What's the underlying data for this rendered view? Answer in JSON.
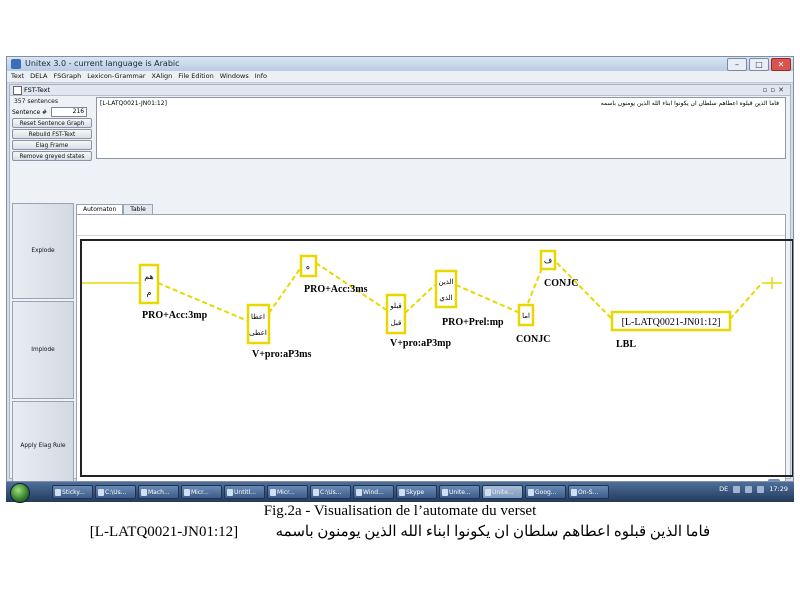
{
  "window": {
    "title": "Unitex 3.0 - current language is Arabic",
    "menu": [
      "Text",
      "DELA",
      "FSGraph",
      "Lexicon-Grammar",
      "XAlign",
      "File Edition",
      "Windows",
      "Info"
    ],
    "controls": {
      "minimize": "–",
      "maximize": "□",
      "close": "✕"
    }
  },
  "fst_text": {
    "title": "FST-Text",
    "sentences_label": "357 sentences",
    "sentence_label": "Sentence #",
    "sentence_value": "216",
    "buttons": [
      "Reset Sentence Graph",
      "Rebuild FST-Text",
      "Elag Frame",
      "Remove greyed states"
    ],
    "sentence_ref": "[L-LATQ0021-JN01:12]",
    "sentence_arabic": "فاما الذين قبلوه اعطاهم سلطان ان يكونوا ابناء الله الذين يومنون باسمه",
    "tabs": [
      "Automaton",
      "Table"
    ],
    "side_buttons": [
      "Explode",
      "Implode",
      "Apply Elag Rule"
    ]
  },
  "graph": {
    "boxes": [
      {
        "lines": [
          "هم",
          "م"
        ],
        "label": "PRO+Acc:3mp"
      },
      {
        "lines": [
          "اعطا",
          "اعطى"
        ],
        "label": "V+pro:aP3ms"
      },
      {
        "lines": [
          "ه"
        ],
        "label": "PRO+Acc:3ms"
      },
      {
        "lines": [
          "قبلو",
          "قبل"
        ],
        "label": "V+pro:aP3mp"
      },
      {
        "lines": [
          "الذين",
          "الذي"
        ],
        "label": "PRO+Prel:mp"
      },
      {
        "lines": [
          "اما"
        ],
        "label": "CONJC"
      },
      {
        "lines": [
          "ف"
        ],
        "label": "CONJC"
      },
      {
        "lines": [
          "[L-LATQ0021-JN01:12]"
        ],
        "label": "LBL"
      }
    ]
  },
  "taskbar": {
    "items": [
      "Sticky...",
      "C:\\Us...",
      "Mach...",
      "Micr...",
      "Untitl...",
      "Micr...",
      "C:\\Us...",
      "Wind...",
      "Skype",
      "Unite...",
      "Unite...",
      "Goog...",
      "On-S..."
    ],
    "lang": "DE",
    "time": "17:29"
  },
  "caption": {
    "line1": "Fig.2a -  Visualisation de l’automate du verset",
    "ref": "[L-LATQ0021-JN01:12]",
    "arabic": "فاما الذين قبلوه اعطاهم سلطان ان يكونوا ابناء الله الذين يومنون باسمه"
  },
  "colors": {
    "box": "#e8d800",
    "edge": "#e8d800",
    "frame": "#222222"
  }
}
